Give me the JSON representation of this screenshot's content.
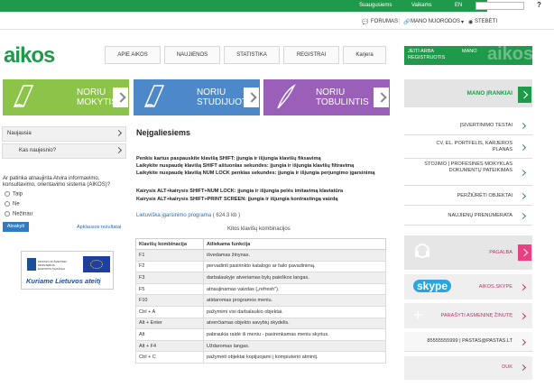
{
  "topbar": {
    "links": [
      "Suaugusiems",
      "Vaikams"
    ],
    "lang": "EN",
    "help": "?"
  },
  "subbar": {
    "forumas": "FORUMAS",
    "mano_nuorodos": "MANO NUORODOS",
    "stebeti": "STEBĖTI"
  },
  "logo": "aikos",
  "nav": {
    "items": [
      "APIE AIKOS",
      "NAUJIENOS",
      "STATISTIKA",
      "REGISTRAI",
      "Karjera"
    ],
    "login": "JEITI ARBA\nREGISTRUOTIS",
    "mano": "MANO",
    "watermark": "aikos"
  },
  "tiles": [
    {
      "label": "NORIU\nMOKYTIS",
      "color": "#8cc44a"
    },
    {
      "label": "NORIU\nSTUDIJUOTI",
      "color": "#4d88c8"
    },
    {
      "label": "NORIU\nTOBULINTIS",
      "color": "#9a5fb8"
    }
  ],
  "left": {
    "tabs": [
      "Naujausia",
      "Kas naujesnio?"
    ],
    "poll_question": "Ar patinka atnaujinta Atvira informavimo, konsultavimo, orientavimo sistema (AIKOS)?",
    "options": [
      "Taip",
      "Ne",
      "Nežinau"
    ],
    "vote": "Atsakyti",
    "results": "Apklausos rezultatai",
    "banner_small": "MOKSLO IR ŠVIETIMO MINISTERIJA\nEUROPOS SĄJUNGA",
    "banner_text": "Kuriame Lietuvos ateitį"
  },
  "main": {
    "title": "Neįgaliesiems",
    "para1": "Penkis kartus paspauskite klavišą SHIFT: įjungia ir išjungia klavišų fiksavimą",
    "para2": "Laikykite nuspaudę klavišą SHIFT aštuonias sekundes: įjungia ir išjungia klavišų filtravimą",
    "para3": "Laikykite nuspaudę klavišą NUM LOCK penkias sekundes: įjungia ir išjungia perjungimo įgarsinimą",
    "para4": "Kairysis ALT+kairysis SHIFT+NUM LOCK: įjungia ir išjungia pelės imitavimą klaviatūra",
    "para5": "Kairysis ALT+kairysis SHIFT+PRINT SCREEN: įjungia ir išjungia kontrastingą vaizdą",
    "link": "Lietuviška įgarsinimo programa",
    "link_size": "( 624.3 kb )",
    "caption": "Kitos klavišų kombinacijos",
    "table": {
      "headers": [
        "Klavišų kombinacija",
        "Atliekama funkcija"
      ],
      "rows": [
        [
          "F1",
          "išvedamas žinynas."
        ],
        [
          "F2",
          "pervadinti pasirinkto katalogo ar failo pavadinimą."
        ],
        [
          "F3",
          "darbalaukyje atveriamas bylų paieškos langas."
        ],
        [
          "F5",
          "atnaujinamas vaizdas („refresh\")."
        ],
        [
          "F10",
          "atidaromas programos meniu."
        ],
        [
          "Ctrl + A",
          "pažymimi visi darbalaukio objektai."
        ],
        [
          "Alt + Enter",
          "atverčiamas objekto savybių skydelis."
        ],
        [
          "Alt",
          "pabraukia raidė iš meniu - pasirenkamas meniu skyrius."
        ],
        [
          "Alt + F4",
          "Uždaromas langas."
        ],
        [
          "Ctrl + C",
          "pažymėti objektai kopijuojami į kompiuterio atmintį."
        ]
      ]
    }
  },
  "right": {
    "head": "MANO ĮRANKIAI",
    "items": [
      "ĮSIVERTINIMO TESTAI",
      "CV, EL. PORTFELIS, KARJEROS PLANAS",
      "STOJIMO | PROFESINES MOKYKLAS DOKUMENTŲ PATEIKIMAS",
      "PERŽIŪRĖTI OBJEKTAI",
      "NAUJIENŲ PRENUMERATA"
    ],
    "pagalba": "PAGALBA",
    "skype_logo": "skype",
    "skype": "AIKOS.SKYPE",
    "note": "PARAŠYTI ASMENINĘ ŽINUTĘ",
    "phone": "85555555999",
    "email": "PASTAS@PASTAS.LT",
    "duk": "DUK"
  },
  "colors": {
    "brand_green": "#1f9a4b",
    "pink": "#e8417f"
  }
}
